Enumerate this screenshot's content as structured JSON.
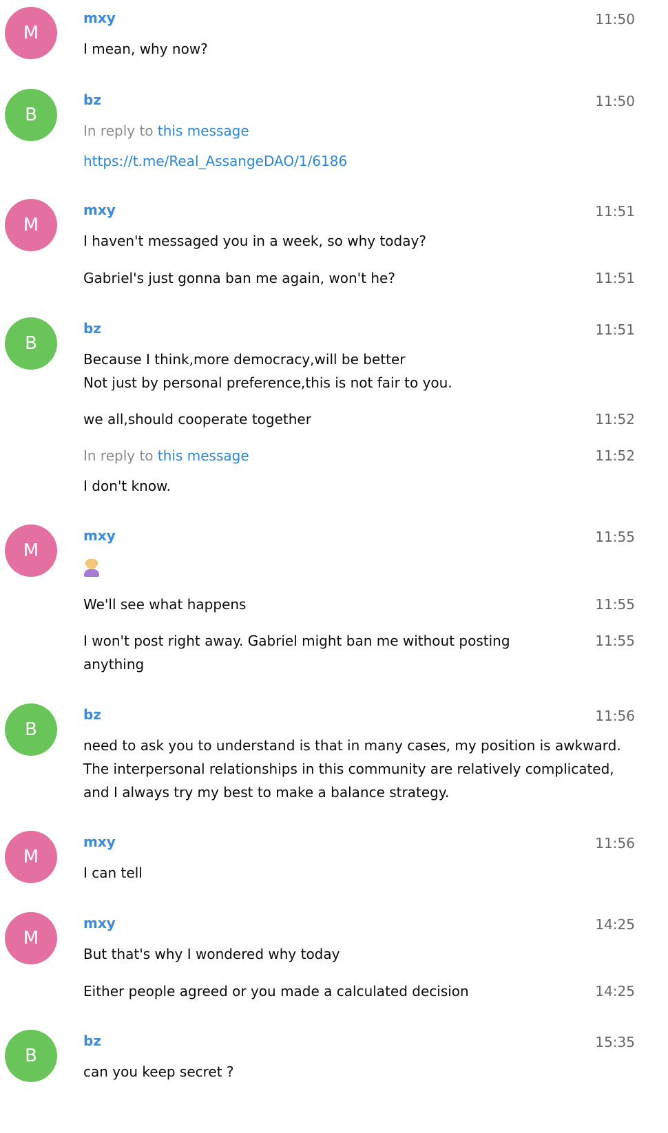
{
  "messages": [
    {
      "initial": "M",
      "author": "mxy",
      "time": "11:50",
      "lines": [
        {
          "text": "I mean, why now?"
        }
      ]
    },
    {
      "initial": "B",
      "author": "bz",
      "time": "11:50",
      "reply_prefix": "In reply to",
      "reply_link": "this message",
      "lines": [
        {
          "text": "https://t.me/Real_AssangeDAO/1/6186"
        }
      ]
    },
    {
      "initial": "M",
      "author": "mxy",
      "time": "11:51",
      "lines": [
        {
          "text": "I haven't messaged you in a week, so why today?"
        },
        {
          "text": "Gabriel's just gonna ban me again, won't he?",
          "time": "11:51"
        }
      ]
    },
    {
      "initial": "B",
      "author": "bz",
      "time": "11:51",
      "lines": [
        {
          "text": "Because I think,more democracy,will be better\nNot just by personal preference,this is not fair to you."
        },
        {
          "text": "we all,should cooperate together",
          "time": "11:52"
        },
        {
          "reply_prefix": "In reply to",
          "reply_link": "this message",
          "time": "11:52"
        },
        {
          "text": "I don't know."
        }
      ]
    },
    {
      "initial": "M",
      "author": "mxy",
      "time": "11:55",
      "lines": [
        {
          "emoji": "person-gesturing-no-emoji"
        },
        {
          "text": "We'll see what happens",
          "time": "11:55"
        },
        {
          "text": "I won't post right away. Gabriel might ban me without posting anything",
          "time": "11:55"
        }
      ]
    },
    {
      "initial": "B",
      "author": "bz",
      "time": "11:56",
      "lines": [
        {
          "text": "need to ask you to understand is that in many cases, my position is awkward. The interpersonal relationships in this community are relatively complicated, and I always try my best to make a balance strategy."
        }
      ]
    },
    {
      "initial": "M",
      "author": "mxy",
      "time": "11:56",
      "lines": [
        {
          "text": "I can tell"
        }
      ]
    },
    {
      "initial": "M",
      "author": "mxy",
      "time": "14:25",
      "lines": [
        {
          "text": "But that's why I wondered why today"
        },
        {
          "text": "Either people agreed or you made a calculated decision",
          "time": "14:25"
        }
      ]
    },
    {
      "initial": "B",
      "author": "bz",
      "time": "15:35",
      "lines": [
        {
          "text": "can you keep secret ?"
        }
      ]
    }
  ]
}
